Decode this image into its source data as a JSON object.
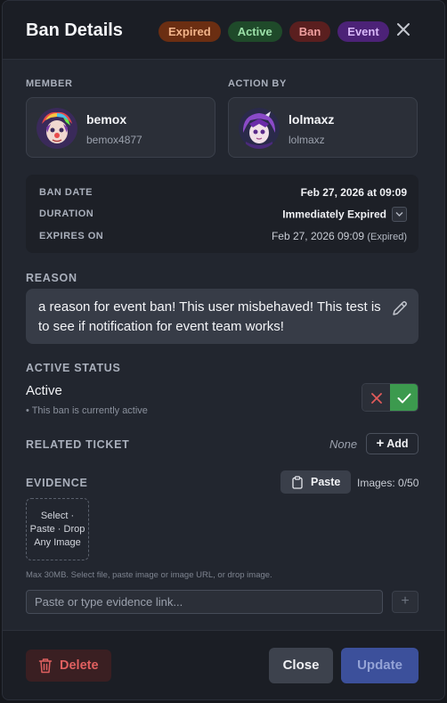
{
  "header": {
    "title": "Ban Details",
    "badges": [
      "Expired",
      "Active",
      "Ban",
      "Event"
    ],
    "close_icon": "close-icon"
  },
  "member": {
    "label": "MEMBER",
    "name": "bemox",
    "tag": "bemox4877"
  },
  "action_by": {
    "label": "ACTION BY",
    "name": "lolmaxz",
    "tag": "lolmaxz"
  },
  "info": {
    "ban_date_label": "BAN DATE",
    "ban_date_value": "Feb 27, 2026 at 09:09",
    "duration_label": "DURATION",
    "duration_value": "Immediately Expired",
    "expires_label": "EXPIRES ON",
    "expires_value": "Feb 27, 2026 09:09",
    "expires_note": "(Expired)"
  },
  "reason": {
    "label": "REASON",
    "text": "a reason for event ban! This user misbehaved! This test is to see if notification for event team works!"
  },
  "active_status": {
    "label": "ACTIVE STATUS",
    "value": "Active",
    "sub": "• This ban is currently active"
  },
  "related_ticket": {
    "label": "RELATED TICKET",
    "value": "None",
    "add_label": "Add"
  },
  "evidence": {
    "label": "EVIDENCE",
    "paste_label": "Paste",
    "images_count": "Images: 0/50",
    "drop_line1": "Select ·",
    "drop_line2": "Paste · Drop",
    "drop_line3": "Any Image",
    "max_text": "Max 30MB. Select file, paste image or image URL, or drop image.",
    "link_placeholder": "Paste or type evidence link...",
    "plus": "+"
  },
  "footer": {
    "delete_label": "Delete",
    "close_label": "Close",
    "update_label": "Update"
  },
  "colors": {
    "accent": "#3c509b",
    "success": "#3c9a4e",
    "danger": "#e06060"
  }
}
